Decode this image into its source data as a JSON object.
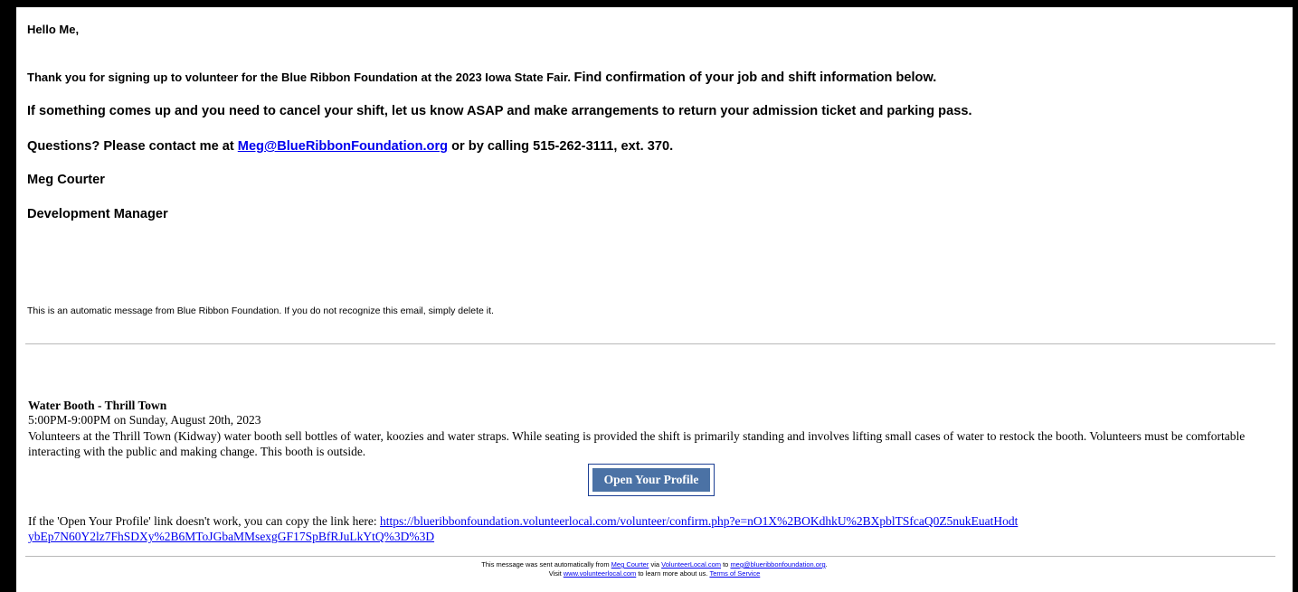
{
  "greeting": "Hello Me,",
  "body": {
    "line1_a": "Thank you for signing up to volunteer for the Blue Ribbon Foundation at the 2023 Iowa State Fair. ",
    "line1_b": "Find confirmation of your job and shift information below.",
    "line2": "If something comes up and you need to cancel your shift, let us know ASAP and make arrangements to return your admission ticket and parking pass.",
    "line3_pre": "Questions? Please contact me at ",
    "line3_email": "Meg@BlueRibbonFoundation.org",
    "line3_post": " or by calling 515-262-3111, ext. 370.",
    "signer_name": "Meg Courter",
    "signer_title": "Development Manager"
  },
  "auto_message": "This is an automatic message from Blue Ribbon Foundation. If you do not recognize this email, simply delete it.",
  "job": {
    "title": "Water Booth - Thrill Town",
    "time": "5:00PM-9:00PM on Sunday, August 20th, 2023",
    "description": "Volunteers at the Thrill Town (Kidway) water booth sell bottles of water, koozies and water straps. While seating is provided the shift is primarily standing and involves lifting small cases of water to restock the booth. Volunteers must be comfortable interacting with the public and making change. This booth is outside."
  },
  "profile_button": "Open Your Profile",
  "copy_link": {
    "text": "If the 'Open Your Profile' link doesn't work, you can copy the link here: ",
    "url": "https://blueribbonfoundation.volunteerlocal.com/volunteer/confirm.php?e=nO1X%2BOKdhkU%2BXpblTSfcaQ0Z5nukEuatHodtybEp7N60Y2lz7FhSDXy%2B6MToJGbaMMsexgGF17SpBfRJuLkYtQ%3D%3D"
  },
  "footer": {
    "pre": "This message was sent automatically from ",
    "sender": "Meg Courter",
    "via": " via ",
    "service": "VolunteerLocal.com",
    "to": " to ",
    "recipient_email": "meg@blueribbonfoundation.org",
    "end": ".",
    "visit": "Visit ",
    "site": "www.volunteerlocal.com",
    "learn": " to learn more about us. ",
    "terms": "Terms of Service"
  }
}
